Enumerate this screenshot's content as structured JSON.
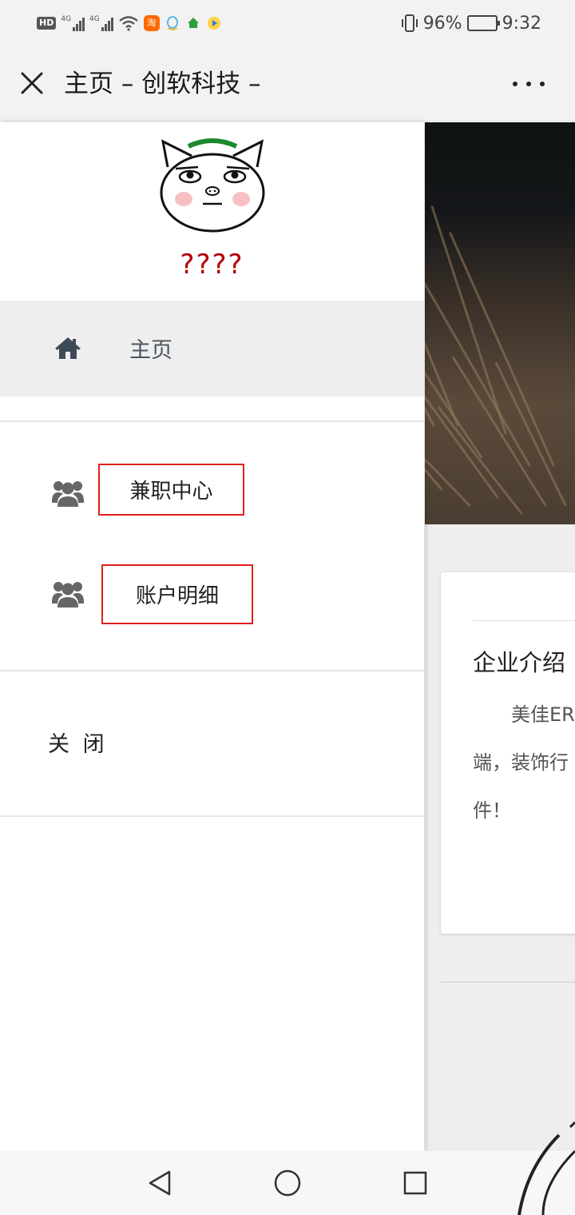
{
  "status_bar": {
    "hd_badge": "HD",
    "network_1": "4G",
    "network_2": "4G",
    "app_icons": [
      "taobao-icon",
      "qq-icon",
      "home-app-icon",
      "video-app-icon"
    ],
    "battery_percent": "96%",
    "battery_level": 0.96,
    "time": "9:32"
  },
  "title_bar": {
    "title": "主页 – 创软科技 –",
    "close_icon": "close-icon",
    "more_icon": "more-dots-icon"
  },
  "drawer": {
    "username": "????",
    "home_label": "主页",
    "menu_items": [
      {
        "label": "兼职中心",
        "icon": "users-group-icon"
      },
      {
        "label": "账户明细",
        "icon": "users-group-icon"
      }
    ],
    "close_label": "关 闭"
  },
  "page": {
    "card_title": "企业介绍",
    "card_lines": [
      "　　美佳ER",
      "端，装饰行",
      "件！"
    ]
  },
  "colors": {
    "highlight_box": "#e0201c",
    "username": "#b00000",
    "icon_gray": "#666666"
  },
  "nav_bar": {
    "back_icon": "back-triangle-icon",
    "home_icon": "home-circle-icon",
    "recents_icon": "recents-square-icon"
  }
}
